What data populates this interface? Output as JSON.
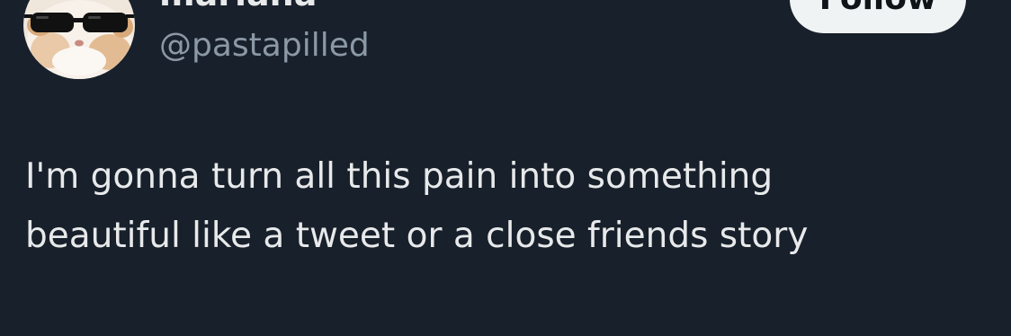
{
  "author": {
    "display_name": "mariana",
    "handle": "@pastapilled",
    "avatar_icon": "avatar-cat-sunglasses"
  },
  "follow_button": {
    "label": "Follow"
  },
  "tweet": {
    "lines": [
      "I'm gonna turn all this pain into something",
      "beautiful like a tweet or a close friends story"
    ]
  },
  "colors": {
    "background": "#18202b",
    "text_primary": "#e7e9ea",
    "text_secondary": "#8b98a5",
    "button_bg": "#eff3f4",
    "button_text": "#0f1419"
  }
}
